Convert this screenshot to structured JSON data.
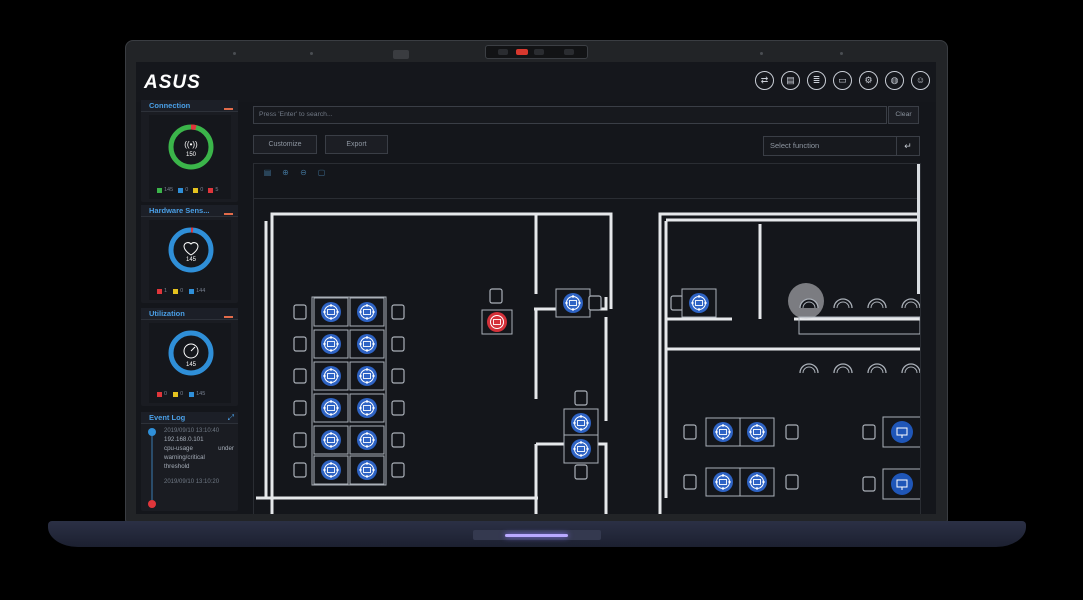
{
  "app": {
    "logo": "ASUS"
  },
  "topbar": {
    "icons": [
      "transfer-icon",
      "device-icon",
      "server-icon",
      "monitor-icon",
      "settings-icon",
      "globe-icon",
      "user-icon"
    ]
  },
  "sidebar": {
    "connection": {
      "title": "Connection",
      "center_value": "150",
      "center_icon": "wireless-icon",
      "legend": [
        {
          "color": "#3bb54a",
          "value": "145"
        },
        {
          "color": "#2f8fd8",
          "value": "0"
        },
        {
          "color": "#e4c21f",
          "value": "0"
        },
        {
          "color": "#e0363b",
          "value": "5"
        }
      ]
    },
    "hardware": {
      "title": "Hardware Sens...",
      "center_value": "145",
      "center_icon": "heart-pulse-icon",
      "legend": [
        {
          "color": "#e0363b",
          "value": "1"
        },
        {
          "color": "#e4c21f",
          "value": "0"
        },
        {
          "color": "#2f8fd8",
          "value": "144"
        }
      ]
    },
    "utilization": {
      "title": "Utilization",
      "center_value": "145",
      "center_icon": "speedometer-icon",
      "legend": [
        {
          "color": "#e0363b",
          "value": "0"
        },
        {
          "color": "#e4c21f",
          "value": "0"
        },
        {
          "color": "#2f8fd8",
          "value": "145"
        }
      ]
    },
    "event_log": {
      "title": "Event Log",
      "first_time": "2019/09/10 13:10:40",
      "ip": "192.168.0.101",
      "msg_1": "cpu-usage",
      "msg_1b": "under",
      "msg_2": "warning/critical",
      "msg_3": "threshold",
      "last_time": "2019/09/10 13:10:20"
    }
  },
  "search": {
    "placeholder": "Press 'Enter' to search...",
    "clear_label": "Clear"
  },
  "toolbar": {
    "customize_label": "Customize",
    "export_label": "Export"
  },
  "function_select": {
    "value": "Select function"
  },
  "map_tools": [
    "document-icon",
    "zoom-in-icon",
    "zoom-out-icon",
    "fit-icon"
  ],
  "colors": {
    "accent_blue": "#2f8fd8",
    "status_green": "#3bb54a",
    "status_red": "#e0363b",
    "status_yellow": "#e4c21f"
  }
}
